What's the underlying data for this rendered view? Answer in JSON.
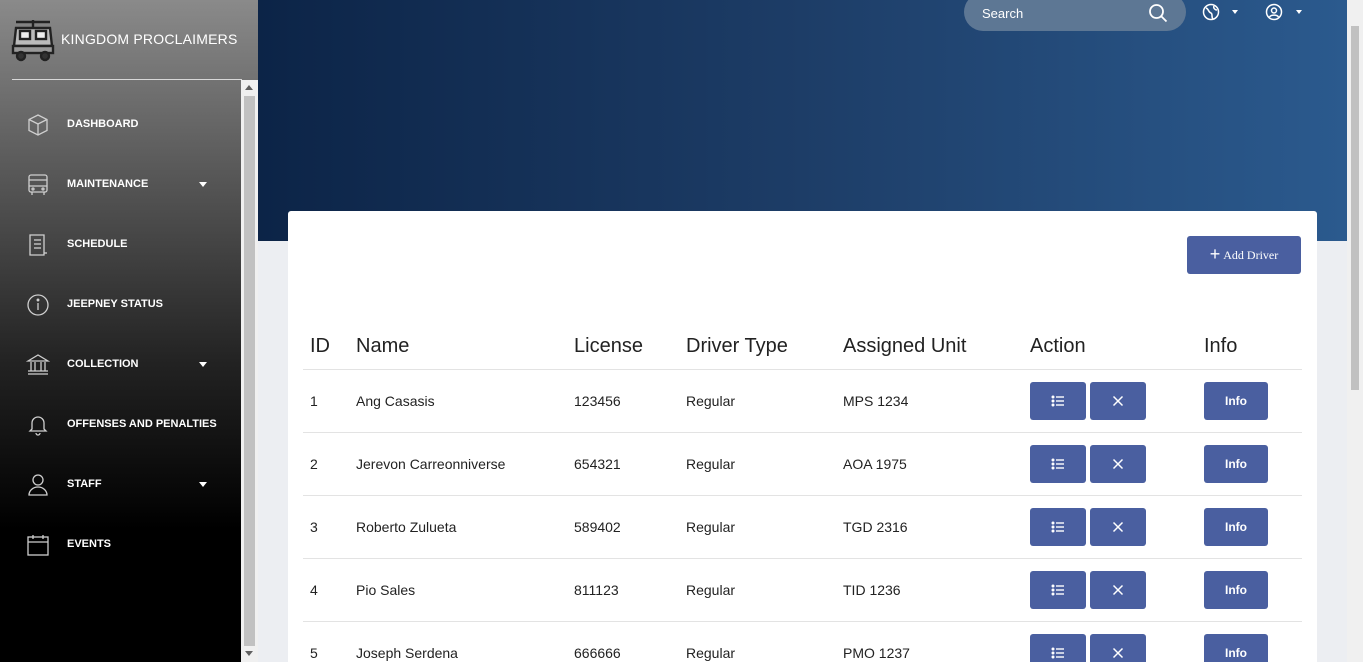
{
  "app": {
    "brand": "KINGDOM PROCLAIMERS"
  },
  "sidebar": {
    "items": [
      {
        "label": "DASHBOARD",
        "icon": "cube-icon",
        "has_caret": false
      },
      {
        "label": "MAINTENANCE",
        "icon": "bus-icon",
        "has_caret": true
      },
      {
        "label": "SCHEDULE",
        "icon": "document-icon",
        "has_caret": false
      },
      {
        "label": "JEEPNEY STATUS",
        "icon": "info-icon",
        "has_caret": false
      },
      {
        "label": "COLLECTION",
        "icon": "bank-icon",
        "has_caret": true
      },
      {
        "label": "OFFENSES AND PENALTIES",
        "icon": "bell-icon",
        "has_caret": false
      },
      {
        "label": "STAFF",
        "icon": "user-icon",
        "has_caret": true
      },
      {
        "label": "EVENTS",
        "icon": "calendar-icon",
        "has_caret": false
      }
    ]
  },
  "header": {
    "search_placeholder": "Search"
  },
  "main": {
    "add_button_label": "Add Driver",
    "table": {
      "columns": [
        "ID",
        "Name",
        "License",
        "Driver Type",
        "Assigned Unit",
        "Action",
        "Info"
      ],
      "rows": [
        {
          "id": "1",
          "name": "Ang Casasis",
          "license": "123456",
          "type": "Regular",
          "unit": "MPS 1234"
        },
        {
          "id": "2",
          "name": "Jerevon Carreonniverse",
          "license": "654321",
          "type": "Regular",
          "unit": "AOA 1975"
        },
        {
          "id": "3",
          "name": "Roberto Zulueta",
          "license": "589402",
          "type": "Regular",
          "unit": "TGD 2316"
        },
        {
          "id": "4",
          "name": "Pio Sales",
          "license": "811123",
          "type": "Regular",
          "unit": "TID 1236"
        },
        {
          "id": "5",
          "name": "Joseph Serdena",
          "license": "666666",
          "type": "Regular",
          "unit": "PMO 1237"
        }
      ],
      "info_label": "Info"
    }
  },
  "colors": {
    "accent": "#4a5fa0",
    "header_dark": "#0c2447",
    "header_light": "#2b5a8e"
  }
}
